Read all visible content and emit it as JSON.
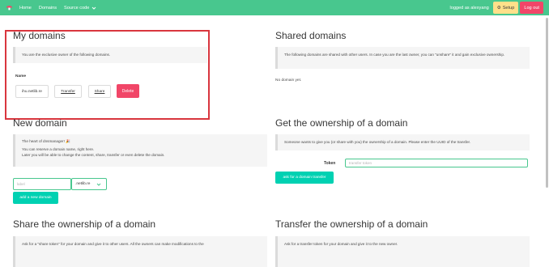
{
  "nav": {
    "logo_icon": "mushroom-icon",
    "home": "Home",
    "domains": "Domains",
    "source_code": "Source code",
    "logged_in": "logged as alexyang",
    "setup": "Setup",
    "setup_icon": "gear-icon",
    "logout": "Log out",
    "colors": {
      "bar": "#48c78e",
      "setup": "#ffe08a",
      "logout": "#f14668"
    }
  },
  "my_domains": {
    "title": "My domains",
    "notice": "You are the exclusive owner of the following domains.",
    "column_header": "Name",
    "rows": [
      {
        "name": "ihu.netlib.re",
        "transfer": "Transfer",
        "share": "Share",
        "delete": "Delete"
      }
    ]
  },
  "shared_domains": {
    "title": "Shared domains",
    "notice": "The following domains are shared with other users. In case you are the last owner, you can \"unshare\" it and gain exclusive ownership.",
    "empty": "No domain yet."
  },
  "new_domain": {
    "title": "New domain",
    "line1": "The heart of dnsmanager! 🎉",
    "line2": "You can reserve a domain name, right here.",
    "line3": "Later you will be able to change the content, share, transfer or even delete the domain.",
    "input_placeholder": "label",
    "tld": ".netlib.re",
    "button": "add a new domain"
  },
  "ownership": {
    "title": "Get the ownership of a domain",
    "notice": "Someone wants to give you (or share with you) the ownership of a domain. Please enter the UUID of the transfer.",
    "token_label": "Token",
    "token_placeholder": "transfer token",
    "button": "ask for a domain transfer"
  },
  "share": {
    "title": "Share the ownership of a domain",
    "notice": "Ask for a \"share token\" for your domain and give it to other users. All the owners can make modifications to the"
  },
  "transfer": {
    "title": "Transfer the ownership of a domain",
    "notice": "Ask for a transfer token for your domain and give it to the new owner."
  }
}
